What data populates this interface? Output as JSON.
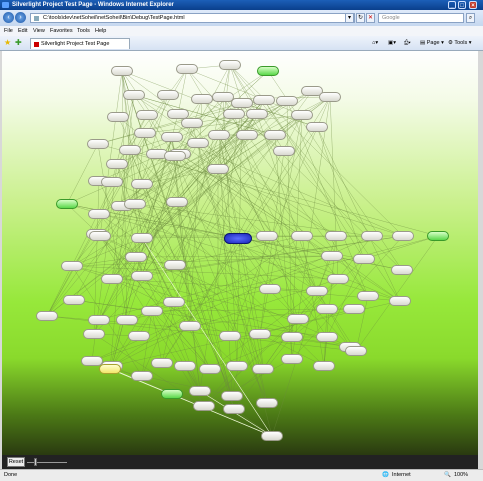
{
  "window": {
    "title": "Silverlight Project Test Page - Windows Internet Explorer"
  },
  "address": {
    "url": "C:\\tools\\dev\\netSoheil\\netSoheil\\Bin\\Debug\\TestPage.html",
    "search_placeholder": "Google"
  },
  "menu": [
    "File",
    "Edit",
    "View",
    "Favorites",
    "Tools",
    "Help"
  ],
  "tab": {
    "label": "Silverlight Project Test Page"
  },
  "toolbar": {
    "page_label": "Page",
    "tools_label": "Tools"
  },
  "controls": {
    "reset_label": "Reset",
    "zoom_slider_value": 0.25
  },
  "status": {
    "done": "Done",
    "zone": "Internet",
    "zoom": "100%"
  },
  "colors": {
    "node": "#e8e8e0",
    "highlight_green": "#6bdc52",
    "highlight_yellow": "#f2e66a",
    "selected_blue": "#2a36d8"
  }
}
